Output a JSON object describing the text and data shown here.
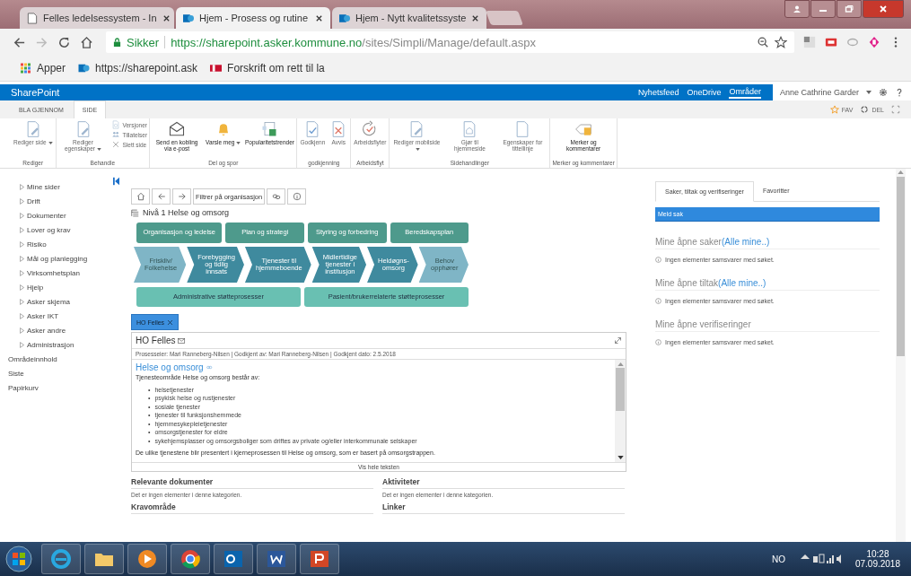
{
  "browser": {
    "tabs": [
      {
        "title": "Felles ledelsessystem - In",
        "selected": false
      },
      {
        "title": "Hjem - Prosess og rutine",
        "selected": true
      },
      {
        "title": "Hjem - Nytt kvalitetssyste",
        "selected": false
      }
    ],
    "secure_label": "Sikker",
    "url_host": "https://sharepoint.asker.kommune.no",
    "url_path": "/sites/Simpli/Manage/default.aspx",
    "bookmarks": [
      "Apper",
      "https://sharepoint.ask",
      "Forskrift om rett til la"
    ]
  },
  "suite_bar": {
    "brand": "SharePoint",
    "links": [
      {
        "label": "Nyhetsfeed",
        "selected": false
      },
      {
        "label": "OneDrive",
        "selected": false
      },
      {
        "label": "Områder",
        "selected": true
      }
    ],
    "user": "Anne Cathrine Garder"
  },
  "ribbon": {
    "tabs": [
      {
        "label": "BLA GJENNOM",
        "selected": false
      },
      {
        "label": "SIDE",
        "selected": true
      }
    ],
    "actions": [
      "FAV",
      "DEL"
    ],
    "groups": [
      {
        "label": "Rediger",
        "buttons": [
          {
            "kind": "large",
            "label": "Rediger side",
            "disabled": true,
            "dropdown": true
          }
        ]
      },
      {
        "label": "Behandle",
        "buttons": [
          {
            "kind": "large",
            "label": "Rediger egenskaper",
            "disabled": true,
            "dropdown": true
          },
          {
            "kind": "small",
            "label": "Versjoner",
            "disabled": true,
            "dropdown": false
          },
          {
            "kind": "small",
            "label": "Tillatelser",
            "disabled": true,
            "dropdown": false
          },
          {
            "kind": "small",
            "label": "Slett side",
            "disabled": true,
            "dropdown": false
          }
        ]
      },
      {
        "label": "Del og spor",
        "buttons": [
          {
            "kind": "large",
            "label": "Send en kobling via e-post",
            "disabled": false,
            "dropdown": false
          },
          {
            "kind": "large",
            "label": "Varsle meg",
            "disabled": false,
            "dropdown": true
          },
          {
            "kind": "large",
            "label": "Popularitetstrender",
            "disabled": false,
            "dropdown": false
          }
        ]
      },
      {
        "label": "godkjenning",
        "buttons": [
          {
            "kind": "large",
            "label": "Godkjenn",
            "disabled": true,
            "dropdown": false
          },
          {
            "kind": "large",
            "label": "Avvis",
            "disabled": true,
            "dropdown": false
          }
        ]
      },
      {
        "label": "Arbeidsflyt",
        "buttons": [
          {
            "kind": "large",
            "label": "Arbeidsflyter",
            "disabled": true,
            "dropdown": false
          }
        ]
      },
      {
        "label": "Sidehandlinger",
        "buttons": [
          {
            "kind": "large",
            "label": "Rediger mobilside",
            "disabled": true,
            "dropdown": true
          },
          {
            "kind": "large",
            "label": "Gjør til hjemmeside",
            "disabled": true,
            "dropdown": false
          },
          {
            "kind": "large",
            "label": "Egenskaper for tittellinje",
            "disabled": true,
            "dropdown": false
          }
        ]
      },
      {
        "label": "Merker og kommentarer",
        "buttons": [
          {
            "kind": "large",
            "label": "Merker og kommentarer",
            "disabled": false,
            "dropdown": false
          }
        ]
      }
    ]
  },
  "left_nav": [
    {
      "label": "Mine sider",
      "kind": "expandable"
    },
    {
      "label": "Drift",
      "kind": "expandable"
    },
    {
      "label": "Dokumenter",
      "kind": "expandable"
    },
    {
      "label": "Lover og krav",
      "kind": "expandable"
    },
    {
      "label": "Risiko",
      "kind": "expandable"
    },
    {
      "label": "Mål og planlegging",
      "kind": "expandable"
    },
    {
      "label": "Virksomhetsplan",
      "kind": "expandable"
    },
    {
      "label": "Hjelp",
      "kind": "expandable"
    },
    {
      "label": "Asker skjema",
      "kind": "expandable"
    },
    {
      "label": "Asker IKT",
      "kind": "expandable"
    },
    {
      "label": "Asker andre",
      "kind": "expandable"
    },
    {
      "label": "Administrasjon",
      "kind": "expandable"
    },
    {
      "label": "Områdeinnhold",
      "kind": "plain"
    },
    {
      "label": "Siste",
      "kind": "plain"
    },
    {
      "label": "Papirkurv",
      "kind": "plain"
    }
  ],
  "process": {
    "filter_button": "Filtrer på organisasjon",
    "level_title": "Nivå 1 Helse og omsorg",
    "management": [
      "Organisasjon og ledelse",
      "Plan og strategi",
      "Styring og forbedring",
      "Beredskapsplan"
    ],
    "core": [
      {
        "label": "Friskliv/ Folkehelse",
        "color": "#7fb5c6"
      },
      {
        "label": "Forebygging og tidlig innsats",
        "color": "#3f8a9e"
      },
      {
        "label": "Tjenester til hjemmeboende",
        "color": "#3f8a9e"
      },
      {
        "label": "Midlertidige tjenester i institusjon",
        "color": "#3f8a9e"
      },
      {
        "label": "Heldøgns-omsorg",
        "color": "#3f8a9e"
      },
      {
        "label": "Behov opphører",
        "color": "#7fb5c6"
      }
    ],
    "support": [
      "Administrative støtteprosesser",
      "Pasient/brukerrelaterte støtteprosesser"
    ]
  },
  "document": {
    "tab": "HO Felles",
    "title": "HO Felles",
    "meta": "Prosesseier: Mari Ranneberg-Nilsen | Godkjent av: Mari Ranneberg-Nilsen | Godkjent dato: 2.5.2018",
    "heading": "Helse og omsorg",
    "bullet_marker": "•",
    "intro": "Tjenesteområde Helse og omsorg består av:",
    "bullets": [
      "helsetjenester",
      "psykisk helse og rustjenester",
      "sosiale tjenester",
      "tjenester til funksjonshemmede",
      "hjemmesykepleietjenester",
      "omsorgstjenester for eldre",
      "sykehjemsplasser og omsorgsboliger som driftes av private og/eller interkommunale selskaper"
    ],
    "closing": "De ulike tjenestene blir presentert i kjerneprosessen til Helse og omsorg, som er basert på omsorgstrappen.",
    "show_all": "Vis hele teksten",
    "sections": [
      {
        "title": "Relevante dokumenter",
        "empty": "Det er ingen elementer i denne kategorien."
      },
      {
        "title": "Aktiviteter",
        "empty": "Det er ingen elementer i denne kategorien."
      },
      {
        "title": "Kravområde"
      },
      {
        "title": "Linker"
      }
    ]
  },
  "side_panel": {
    "tabs": [
      {
        "label": "Saker, tiltak og verifiseringer",
        "selected": true
      },
      {
        "label": "Favoritter",
        "selected": false
      }
    ],
    "report_button": "Meld sak",
    "sections": [
      {
        "title": "Mine åpne saker",
        "link": "(Alle mine..)",
        "empty": "Ingen elementer samsvarer med søket."
      },
      {
        "title": "Mine åpne tiltak",
        "link": "(Alle mine..)",
        "empty": "Ingen elementer samsvarer med søket."
      },
      {
        "title": "Mine åpne verifiseringer",
        "empty": "Ingen elementer samsvarer med søket."
      }
    ]
  },
  "taskbar": {
    "language": "NO",
    "time": "10:28",
    "date": "07.09.2018"
  }
}
